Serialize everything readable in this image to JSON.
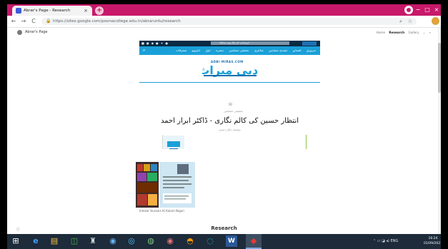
{
  "browser": {
    "tab": {
      "title": "Abrar's Page - Research",
      "close": "×"
    },
    "new_tab": "+",
    "window": {
      "minimize": "−",
      "maximize": "▢",
      "close": "×"
    },
    "nav": {
      "back": "←",
      "forward": "→",
      "reload": "C"
    },
    "url": "https://sites.google.com/poonacollege.edu.in/abrarurdu/research",
    "lock": "🔒",
    "search_ic": "⌕",
    "star_ic": "☆",
    "menu": "⋮"
  },
  "site": {
    "name": "Abrar's Page",
    "nav": [
      "Home",
      "Research",
      "Gallery",
      "⌄",
      "⌕"
    ],
    "active_nav": "Research",
    "footer_title": "Research",
    "footer_icon": "ⓘ"
  },
  "embed": {
    "social": "■ ● ◆ ● ✦ ●",
    "tagline": "اردو ادب کی ایک ویب سائٹ",
    "search_ic": "⌕",
    "nav": [
      "سرورق",
      "افسانے",
      "تنقیدی مضامین",
      "شاعری",
      "تحقیقی مضامین",
      "تبصرے",
      "ناول",
      "انٹرویو",
      "متفرقات"
    ],
    "logo_en": "ADBI MIRAS.COM",
    "logo_ur": "ادبی میراث",
    "post_icon": "⊞",
    "category": "تحقیقی مضامین",
    "post_title": "انتظار حسین کی کالم نگاری - ڈاکٹر ابرار احمد",
    "post_meta": "بواسطہ   |   ٹیگز   |   تبصرہ"
  },
  "photo": {
    "caption": "Intezar Hussain Ki Kalam Nigari"
  },
  "taskbar": {
    "icons": [
      "⊞",
      "e",
      "▤",
      "◫",
      "♜",
      "◉",
      "◎",
      "◍",
      "◉",
      "◓",
      "◌",
      "W",
      "◆"
    ],
    "tray": "⌃  ▭  ◪  ◂)  ENG",
    "time": "16:24",
    "date": "01/09/2021"
  },
  "colors": {
    "tabbar": "#c7186a",
    "site_nav": "#1aa0d8",
    "taskbar": "#1d2b3a"
  }
}
